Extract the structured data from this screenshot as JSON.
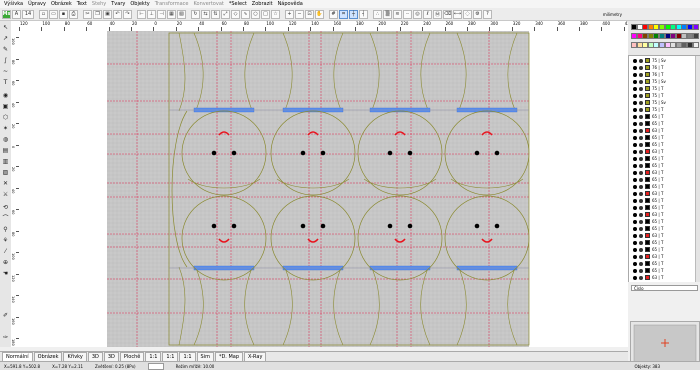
{
  "menu": [
    "Výšivka",
    "Úpravy",
    "Obrázek",
    "Text",
    "Stehy",
    "Tvary",
    "Objekty",
    "Transformace",
    "Konvertovat",
    "*Select",
    "Zobrazit",
    "Nápověda"
  ],
  "menu_dim": [
    false,
    false,
    false,
    false,
    true,
    false,
    false,
    true,
    true,
    false,
    false,
    false
  ],
  "toolbar": {
    "logo_label": "Ms",
    "font_a_label": "A",
    "font_size_label": "14",
    "units_label": "milimetry"
  },
  "ruler_top": {
    "ticks": [
      "120",
      "100",
      "80",
      "60",
      "40",
      "20",
      "0",
      "20",
      "40",
      "60",
      "80",
      "100",
      "120",
      "140",
      "160",
      "180",
      "200",
      "220",
      "240",
      "260",
      "280",
      "300",
      "320",
      "340",
      "360",
      "380",
      "400",
      "420"
    ]
  },
  "ruler_left": {
    "ticks": [
      "100",
      "80",
      "60",
      "40",
      "20",
      "0",
      "20",
      "40",
      "60",
      "80",
      "100",
      "120",
      "140",
      "160",
      "180"
    ]
  },
  "colors": {
    "thread_olive": "#8a8a30",
    "guide_red": "#e0204a",
    "mouth_red": "#e8141e",
    "bar_blue": "#5b8ff0",
    "hoop_gray": "#c3c3c3"
  },
  "palette": [
    "#000000",
    "#ffffff",
    "#ff0000",
    "#ff8000",
    "#ffff00",
    "#80ff00",
    "#00ff00",
    "#00ff80",
    "#00ffff",
    "#0080ff",
    "#0000ff",
    "#8000ff",
    "#ff00ff",
    "#ff0080",
    "#804000",
    "#808000",
    "#008000",
    "#008080",
    "#000080",
    "#800080",
    "#800000",
    "#c0c0c0",
    "#808080",
    "#404040",
    "#ffc0c0",
    "#ffe0a0",
    "#ffffa0",
    "#c0ffc0",
    "#c0ffff",
    "#c0c0ff",
    "#ffc0ff",
    "#e0e0e0",
    "#a0a0a0",
    "#606060",
    "#303030",
    "#f0f0f0"
  ],
  "layers": [
    {
      "swatch": "#a0a020",
      "label": "75 | Sv"
    },
    {
      "swatch": "#a0a020",
      "label": "76 | T"
    },
    {
      "swatch": "#a0a020",
      "label": "76 | T"
    },
    {
      "swatch": "#a0a020",
      "label": "75 | Sv"
    },
    {
      "swatch": "#a0a020",
      "label": "75 | T"
    },
    {
      "swatch": "#a0a020",
      "label": "75 | T"
    },
    {
      "swatch": "#a0a020",
      "label": "75 | Sv"
    },
    {
      "swatch": "#a0a020",
      "label": "75 | T"
    },
    {
      "swatch": "#000000",
      "label": "65 | T"
    },
    {
      "swatch": "#000000",
      "label": "65 | T"
    },
    {
      "swatch": "#e82020",
      "label": "63 | T"
    },
    {
      "swatch": "#000000",
      "label": "65 | T"
    },
    {
      "swatch": "#000000",
      "label": "65 | T"
    },
    {
      "swatch": "#e82020",
      "label": "63 | T"
    },
    {
      "swatch": "#000000",
      "label": "65 | T"
    },
    {
      "swatch": "#000000",
      "label": "65 | T"
    },
    {
      "swatch": "#e82020",
      "label": "63 | T"
    },
    {
      "swatch": "#000000",
      "label": "65 | T"
    },
    {
      "swatch": "#000000",
      "label": "65 | T"
    },
    {
      "swatch": "#e82020",
      "label": "63 | T"
    },
    {
      "swatch": "#000000",
      "label": "65 | T"
    },
    {
      "swatch": "#000000",
      "label": "65 | T"
    },
    {
      "swatch": "#e82020",
      "label": "63 | T"
    },
    {
      "swatch": "#000000",
      "label": "65 | T"
    },
    {
      "swatch": "#000000",
      "label": "65 | T"
    },
    {
      "swatch": "#e82020",
      "label": "63 | T"
    },
    {
      "swatch": "#000000",
      "label": "65 | T"
    },
    {
      "swatch": "#000000",
      "label": "65 | T"
    },
    {
      "swatch": "#e82020",
      "label": "63 | T"
    },
    {
      "swatch": "#000000",
      "label": "65 | T"
    },
    {
      "swatch": "#000000",
      "label": "65 | T"
    },
    {
      "swatch": "#e82020",
      "label": "63 | T"
    }
  ],
  "layer_name_label": "Číslo",
  "view_tabs": [
    "Normální",
    "Obrázek",
    "Křivky",
    "3D",
    "3D",
    "Plochě",
    "1:1",
    "1:1",
    "1:1",
    "Sim",
    "*D. Map",
    "X-Ray"
  ],
  "view_tab_active": 0,
  "status": {
    "coords": "X=591.8  Y=502.8",
    "size": "X=7.28  Y=2.11",
    "scale": "Zvětšení: 0.25 (8Px)",
    "mode": "Režim mřížě: 10.00",
    "objects": "Objekty: 383"
  }
}
